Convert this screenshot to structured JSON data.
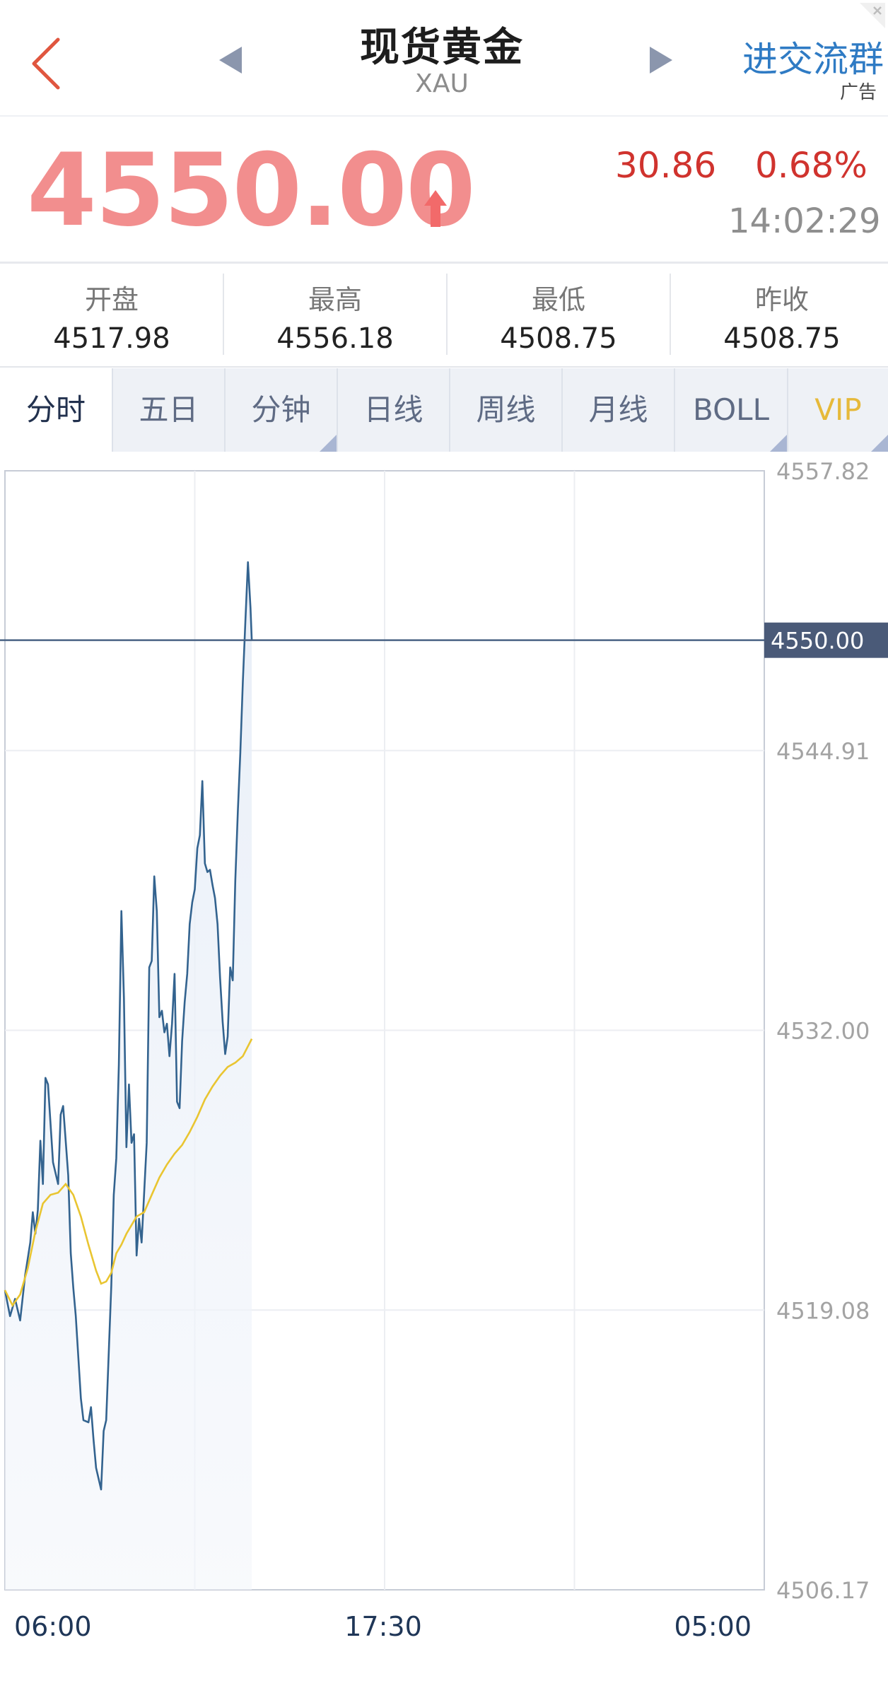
{
  "header": {
    "title": "现货黄金",
    "subtitle": "XAU",
    "join_label": "进交流群",
    "ad_label": "广告"
  },
  "quote": {
    "price": "4550.00",
    "change": "30.86",
    "change_pct": "0.68%",
    "time": "14:02:29"
  },
  "stats": [
    {
      "label": "开盘",
      "value": "4517.98"
    },
    {
      "label": "最高",
      "value": "4556.18"
    },
    {
      "label": "最低",
      "value": "4508.75"
    },
    {
      "label": "昨收",
      "value": "4508.75"
    }
  ],
  "tabs": [
    "分时",
    "五日",
    "分钟",
    "日线",
    "周线",
    "月线",
    "BOLL",
    "VIP"
  ],
  "colors": {
    "price": "#f28e8e",
    "up": "#d0332e",
    "link": "#2f7bc4",
    "line": "#33638f",
    "avg_line": "#e9c531",
    "vip": "#e6b93a"
  },
  "chart_data": {
    "type": "line",
    "x_ticks": [
      "06:00",
      "17:30",
      "05:00"
    ],
    "y_ticks": [
      "4557.82",
      "4544.91",
      "4532.00",
      "4519.08",
      "4506.17"
    ],
    "ylim": [
      4506.17,
      4557.82
    ],
    "current_price_label": "4550.00",
    "current_price": 4550.0,
    "grid": true,
    "series": [
      {
        "role": "price",
        "color": "#33638f",
        "points": [
          [
            0,
            4520.0
          ],
          [
            2,
            4518.8
          ],
          [
            4,
            4519.6
          ],
          [
            6,
            4518.6
          ],
          [
            8,
            4520.7
          ],
          [
            10,
            4522.2
          ],
          [
            11,
            4523.6
          ],
          [
            12,
            4522.6
          ],
          [
            13,
            4523.7
          ],
          [
            14,
            4526.9
          ],
          [
            15,
            4524.9
          ],
          [
            16,
            4529.8
          ],
          [
            17,
            4529.5
          ],
          [
            19,
            4525.9
          ],
          [
            21,
            4524.9
          ],
          [
            22,
            4528.1
          ],
          [
            23,
            4528.5
          ],
          [
            25,
            4525.3
          ],
          [
            26,
            4521.7
          ],
          [
            27,
            4520.1
          ],
          [
            28,
            4518.8
          ],
          [
            30,
            4515.0
          ],
          [
            31,
            4514.0
          ],
          [
            33,
            4513.9
          ],
          [
            34,
            4514.6
          ],
          [
            35,
            4513.1
          ],
          [
            36,
            4511.8
          ],
          [
            38,
            4510.8
          ],
          [
            39,
            4513.5
          ],
          [
            40,
            4514.0
          ],
          [
            42,
            4520.2
          ],
          [
            43,
            4524.4
          ],
          [
            44,
            4526.1
          ],
          [
            45,
            4530.4
          ],
          [
            46,
            4537.5
          ],
          [
            47,
            4533.5
          ],
          [
            48,
            4526.6
          ],
          [
            49,
            4529.5
          ],
          [
            50,
            4526.8
          ],
          [
            51,
            4527.2
          ],
          [
            52,
            4521.6
          ],
          [
            53,
            4523.3
          ],
          [
            54,
            4522.2
          ],
          [
            55,
            4524.5
          ],
          [
            56,
            4526.8
          ],
          [
            57,
            4534.9
          ],
          [
            58,
            4535.2
          ],
          [
            59,
            4539.1
          ],
          [
            60,
            4537.5
          ],
          [
            61,
            4532.6
          ],
          [
            62,
            4532.9
          ],
          [
            63,
            4531.9
          ],
          [
            64,
            4532.3
          ],
          [
            65,
            4530.8
          ],
          [
            66,
            4532.3
          ],
          [
            67,
            4534.6
          ],
          [
            68,
            4528.7
          ],
          [
            69,
            4528.4
          ],
          [
            70,
            4531.5
          ],
          [
            71,
            4533.3
          ],
          [
            72,
            4534.6
          ],
          [
            73,
            4536.9
          ],
          [
            74,
            4537.9
          ],
          [
            75,
            4538.5
          ],
          [
            76,
            4540.4
          ],
          [
            77,
            4541.0
          ],
          [
            78,
            4543.5
          ],
          [
            79,
            4539.7
          ],
          [
            80,
            4539.3
          ],
          [
            81,
            4539.4
          ],
          [
            82,
            4538.7
          ],
          [
            83,
            4538.1
          ],
          [
            84,
            4536.9
          ],
          [
            85,
            4534.4
          ],
          [
            86,
            4532.4
          ],
          [
            87,
            4530.9
          ],
          [
            88,
            4531.7
          ],
          [
            89,
            4534.9
          ],
          [
            90,
            4534.3
          ],
          [
            91,
            4538.9
          ],
          [
            92,
            4542.1
          ],
          [
            93,
            4544.8
          ],
          [
            94,
            4548.1
          ],
          [
            95,
            4550.9
          ],
          [
            96,
            4553.6
          ],
          [
            97,
            4551.5
          ],
          [
            97.5,
            4550.0
          ]
        ]
      },
      {
        "role": "average",
        "color": "#e9c531",
        "points": [
          [
            0,
            4520.0
          ],
          [
            3,
            4519.3
          ],
          [
            6,
            4519.8
          ],
          [
            9,
            4521.0
          ],
          [
            12,
            4522.7
          ],
          [
            15,
            4524.0
          ],
          [
            18,
            4524.4
          ],
          [
            21,
            4524.5
          ],
          [
            24,
            4524.9
          ],
          [
            27,
            4524.4
          ],
          [
            30,
            4523.4
          ],
          [
            33,
            4522.1
          ],
          [
            36,
            4520.9
          ],
          [
            38,
            4520.3
          ],
          [
            40,
            4520.4
          ],
          [
            42,
            4520.8
          ],
          [
            44,
            4521.7
          ],
          [
            46,
            4522.1
          ],
          [
            48,
            4522.6
          ],
          [
            50,
            4523.0
          ],
          [
            52,
            4523.4
          ],
          [
            55,
            4523.6
          ],
          [
            58,
            4524.4
          ],
          [
            61,
            4525.2
          ],
          [
            64,
            4525.8
          ],
          [
            67,
            4526.3
          ],
          [
            70,
            4526.7
          ],
          [
            73,
            4527.3
          ],
          [
            76,
            4528.0
          ],
          [
            79,
            4528.8
          ],
          [
            82,
            4529.4
          ],
          [
            85,
            4529.9
          ],
          [
            88,
            4530.3
          ],
          [
            91,
            4530.5
          ],
          [
            94,
            4530.8
          ],
          [
            97.5,
            4531.6
          ]
        ]
      }
    ]
  }
}
